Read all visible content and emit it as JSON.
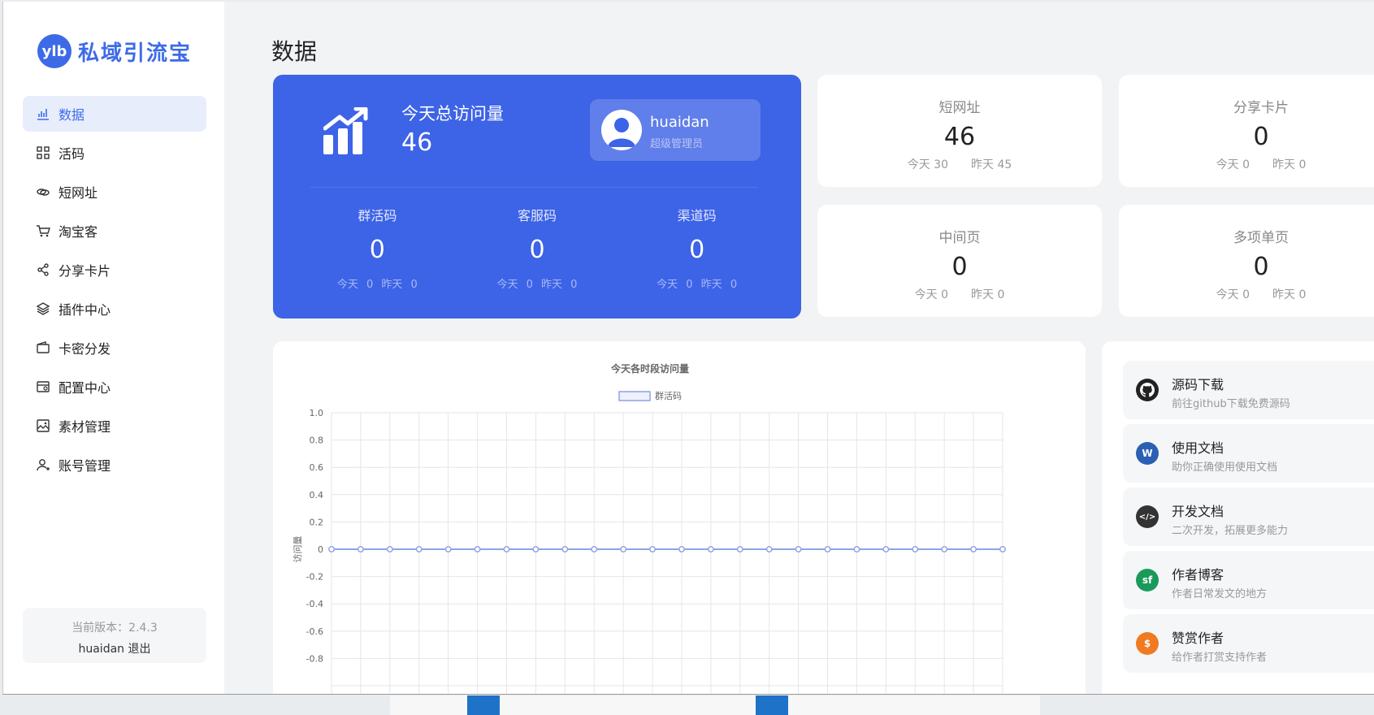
{
  "app": {
    "logo_badge": "ylb",
    "logo_text": "私域引流宝",
    "brand_color": "#3d6be8"
  },
  "sidebar": {
    "items": [
      {
        "label": "数据",
        "icon": "bar-chart-icon",
        "active": true
      },
      {
        "label": "活码",
        "icon": "grid-icon",
        "active": false
      },
      {
        "label": "短网址",
        "icon": "link-icon",
        "active": false
      },
      {
        "label": "淘宝客",
        "icon": "cart-icon",
        "active": false
      },
      {
        "label": "分享卡片",
        "icon": "share-icon",
        "active": false
      },
      {
        "label": "插件中心",
        "icon": "layers-icon",
        "active": false
      },
      {
        "label": "卡密分发",
        "icon": "wallet-icon",
        "active": false
      },
      {
        "label": "配置中心",
        "icon": "settings-card-icon",
        "active": false
      },
      {
        "label": "素材管理",
        "icon": "image-icon",
        "active": false
      },
      {
        "label": "账号管理",
        "icon": "user-add-icon",
        "active": false
      }
    ],
    "version_text": "当前版本：2.4.3",
    "user_name": "huaidan",
    "logout_label": "退出"
  },
  "main": {
    "title": "数据",
    "overview": {
      "visits_label": "今天总访问量",
      "visits_value": "46",
      "profile_name": "huaidan",
      "profile_role": "超级管理员",
      "stats": [
        {
          "label": "群活码",
          "value": "0",
          "today": "今天 0",
          "yesterday": "昨天 0"
        },
        {
          "label": "客服码",
          "value": "0",
          "today": "今天 0",
          "yesterday": "昨天 0"
        },
        {
          "label": "渠道码",
          "value": "0",
          "today": "今天 0",
          "yesterday": "昨天 0"
        }
      ]
    },
    "cards": [
      {
        "label": "短网址",
        "value": "46",
        "today": "今天 30",
        "yesterday": "昨天 45"
      },
      {
        "label": "分享卡片",
        "value": "0",
        "today": "今天 0",
        "yesterday": "昨天 0"
      },
      {
        "label": "中间页",
        "value": "0",
        "today": "今天 0",
        "yesterday": "昨天 0"
      },
      {
        "label": "多项单页",
        "value": "0",
        "today": "今天 0",
        "yesterday": "昨天 0"
      }
    ],
    "links": [
      {
        "title": "源码下载",
        "desc": "前往github下载免费源码",
        "icon": "github-icon",
        "color": "#222222"
      },
      {
        "title": "使用文档",
        "desc": "助你正确使用使用文档",
        "icon": "word-doc-icon",
        "color": "#2b5fb4"
      },
      {
        "title": "开发文档",
        "desc": "二次开发，拓展更多能力",
        "icon": "code-icon",
        "color": "#333333"
      },
      {
        "title": "作者博客",
        "desc": "作者日常发文的地方",
        "icon": "sf-icon",
        "color": "#1a9a5a"
      },
      {
        "title": "赞赏作者",
        "desc": "给作者打赏支持作者",
        "icon": "money-icon",
        "color": "#f07a22"
      }
    ]
  },
  "chart_data": {
    "type": "line",
    "title": "今天各时段访问量",
    "ylabel": "访问量",
    "xlabel": "",
    "ylim": [
      -1,
      1
    ],
    "yticks": [
      "1.0",
      "0.8",
      "0.6",
      "0.4",
      "0.2",
      "0",
      "-0.2",
      "-0.4",
      "-0.6",
      "-0.8"
    ],
    "legend_position": "top",
    "grid": true,
    "series": [
      {
        "name": "群活码",
        "color": "#8fa3e6",
        "values": [
          0,
          0,
          0,
          0,
          0,
          0,
          0,
          0,
          0,
          0,
          0,
          0,
          0,
          0,
          0,
          0,
          0,
          0,
          0,
          0,
          0,
          0,
          0,
          0
        ]
      }
    ]
  }
}
